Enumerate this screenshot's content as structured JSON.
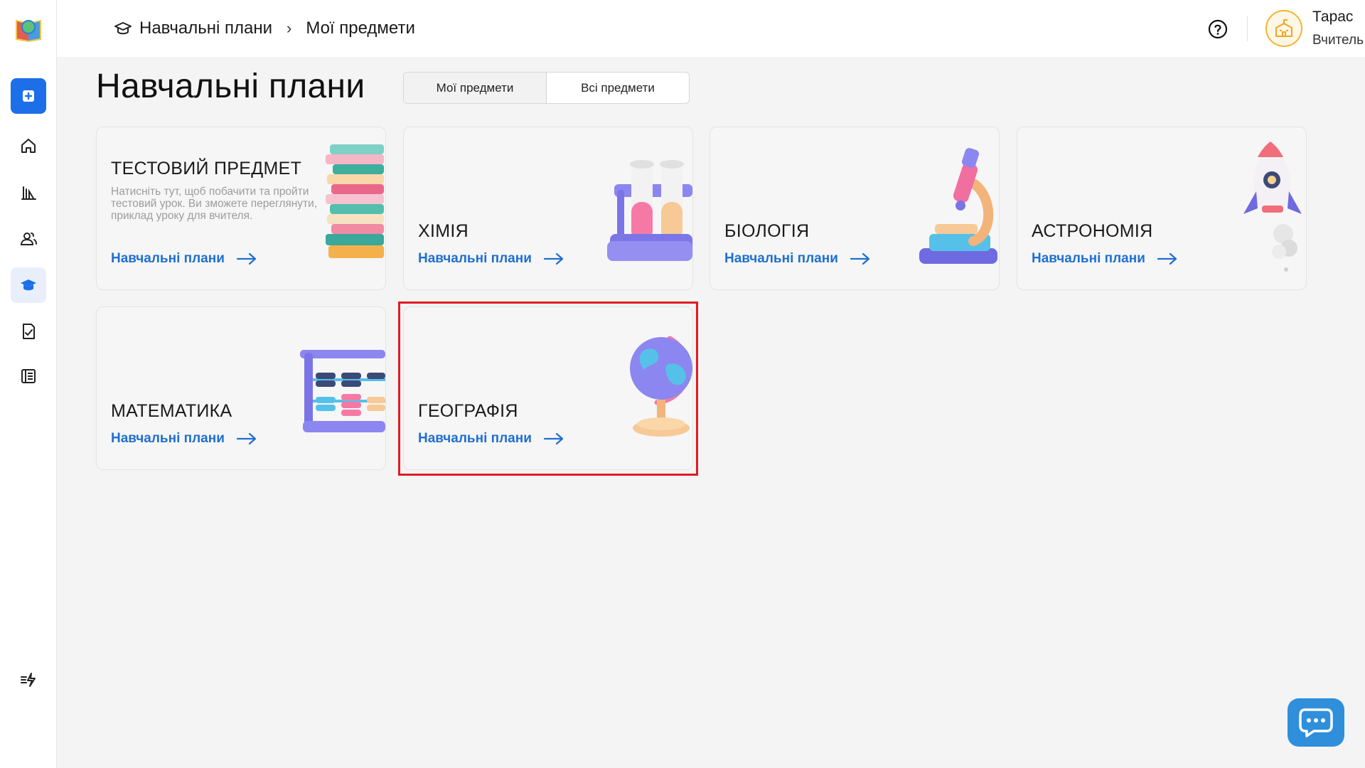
{
  "breadcrumb": {
    "root": "Навчальні плани",
    "current": "Мої предмети"
  },
  "user": {
    "name": "Тарас",
    "role": "Вчитель"
  },
  "page": {
    "title": "Навчальні плани"
  },
  "tabs": [
    {
      "label": "Мої предмети",
      "selected": true
    },
    {
      "label": "Всі предмети",
      "selected": false
    }
  ],
  "cards": [
    {
      "title": "ТЕСТОВИЙ ПРЕДМЕТ",
      "description": "Натисніть тут, щоб побачити та пройти тестовий урок. Ви зможете переглянути, приклад уроку для вчителя.",
      "link": "Навчальні плани",
      "icon": "books-icon"
    },
    {
      "title": "ХІМІЯ",
      "description": "",
      "link": "Навчальні плани",
      "icon": "test-tubes-icon"
    },
    {
      "title": "БІОЛОГІЯ",
      "description": "",
      "link": "Навчальні плани",
      "icon": "microscope-icon"
    },
    {
      "title": "АСТРОНОМІЯ",
      "description": "",
      "link": "Навчальні плани",
      "icon": "rocket-icon"
    },
    {
      "title": "МАТЕМАТИКА",
      "description": "",
      "link": "Навчальні плани",
      "icon": "abacus-icon"
    },
    {
      "title": "ГЕОГРАФІЯ",
      "description": "",
      "link": "Навчальні плани",
      "icon": "globe-icon"
    }
  ],
  "colors": {
    "accent": "#1c6fe8",
    "link": "#1f6fd1",
    "highlight": "#e01b24",
    "chat": "#2f8fdb",
    "avatar_ring": "#f5b330"
  }
}
